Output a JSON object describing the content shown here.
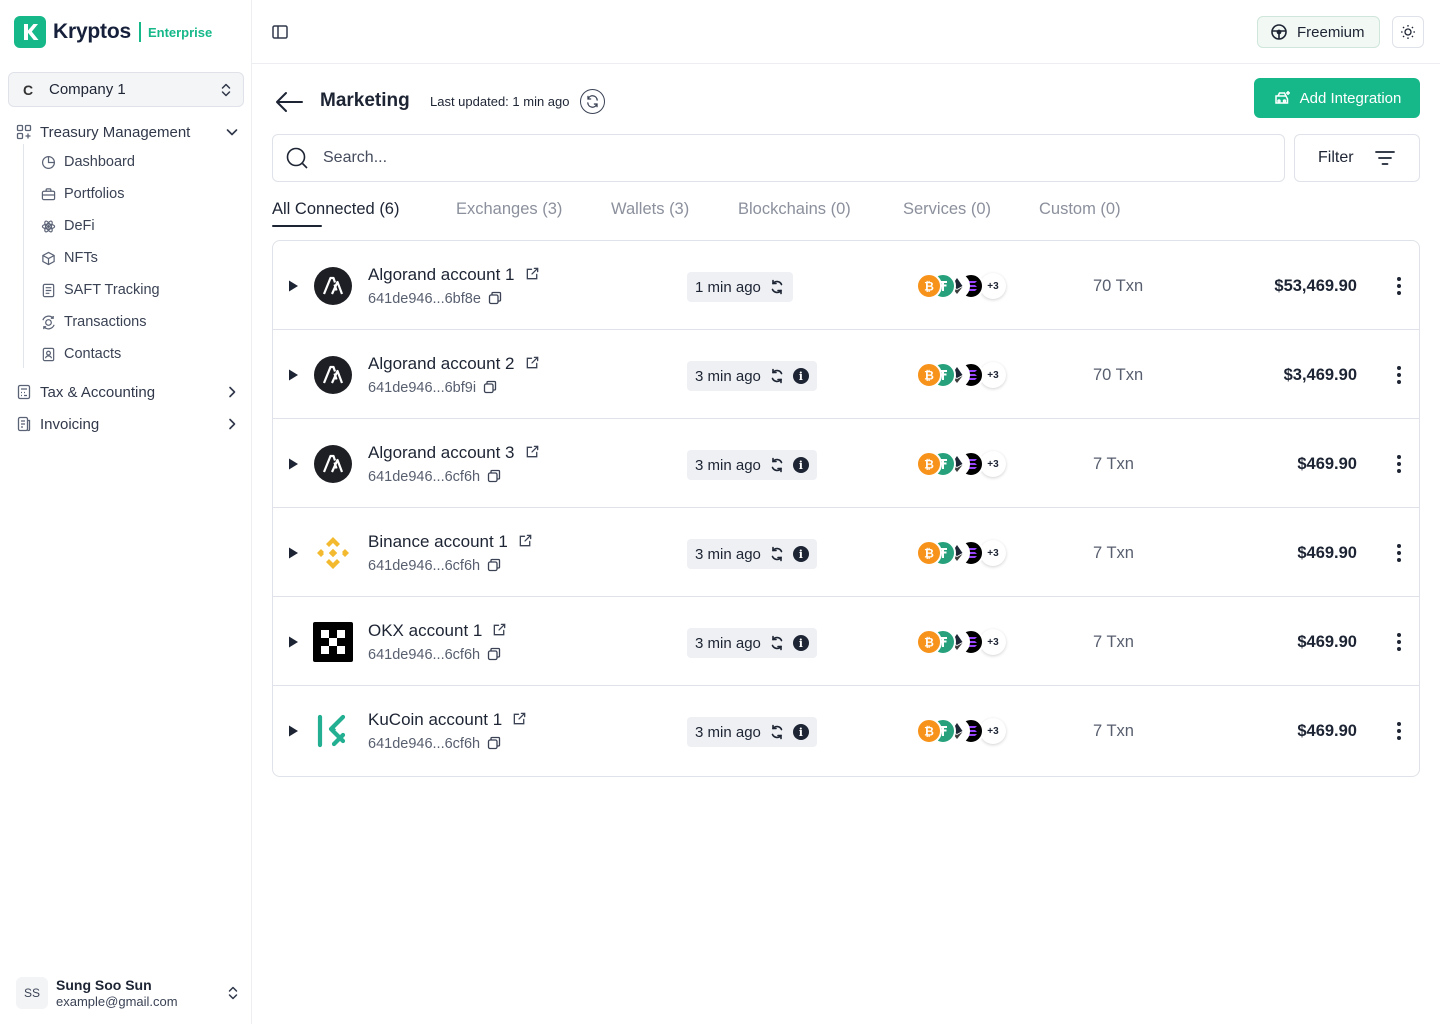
{
  "brand": {
    "name": "Kryptos",
    "tag": "Enterprise",
    "accent": "#16b88a"
  },
  "company": {
    "badge": "C",
    "name": "Company 1"
  },
  "nav": {
    "treasury": {
      "label": "Treasury Management",
      "items": [
        {
          "label": "Dashboard",
          "icon": "pie-chart-icon"
        },
        {
          "label": "Portfolios",
          "icon": "briefcase-icon"
        },
        {
          "label": "DeFi",
          "icon": "atom-icon"
        },
        {
          "label": "NFTs",
          "icon": "cube-icon"
        },
        {
          "label": "SAFT Tracking",
          "icon": "document-icon"
        },
        {
          "label": "Transactions",
          "icon": "transactions-icon"
        },
        {
          "label": "Contacts",
          "icon": "contact-icon"
        }
      ]
    },
    "tax": {
      "label": "Tax & Accounting"
    },
    "invoicing": {
      "label": "Invoicing"
    }
  },
  "user": {
    "initials": "SS",
    "name": "Sung Soo Sun",
    "email": "example@gmail.com"
  },
  "topbar": {
    "plan": "Freemium"
  },
  "header": {
    "title": "Marketing",
    "updated": "Last updated: 1 min ago",
    "add_label": "Add Integration"
  },
  "search": {
    "placeholder": "Search..."
  },
  "filter": {
    "label": "Filter"
  },
  "tabs": [
    {
      "label": "All Connected (6)",
      "active": true
    },
    {
      "label": "Exchanges (3)"
    },
    {
      "label": "Wallets (3)"
    },
    {
      "label": "Blockchains (0)"
    },
    {
      "label": "Services (0)"
    },
    {
      "label": "Custom (0)"
    }
  ],
  "rows": [
    {
      "name": "Algorand account 1",
      "address": "641de946...6bf8e",
      "synced": "1 min ago",
      "info": false,
      "coins_more": "+3",
      "txn": "70 Txn",
      "value": "$53,469.90",
      "logo": "algorand"
    },
    {
      "name": "Algorand account 2",
      "address": "641de946...6bf9i",
      "synced": "3 min ago",
      "info": true,
      "coins_more": "+3",
      "txn": "70 Txn",
      "value": "$3,469.90",
      "logo": "algorand"
    },
    {
      "name": "Algorand account 3",
      "address": "641de946...6cf6h",
      "synced": "3 min ago",
      "info": true,
      "coins_more": "+3",
      "txn": "7 Txn",
      "value": "$469.90",
      "logo": "algorand"
    },
    {
      "name": "Binance account 1",
      "address": "641de946...6cf6h",
      "synced": "3 min ago",
      "info": true,
      "coins_more": "+3",
      "txn": "7 Txn",
      "value": "$469.90",
      "logo": "binance"
    },
    {
      "name": "OKX account 1",
      "address": "641de946...6cf6h",
      "synced": "3 min ago",
      "info": true,
      "coins_more": "+3",
      "txn": "7 Txn",
      "value": "$469.90",
      "logo": "okx"
    },
    {
      "name": "KuCoin account 1",
      "address": "641de946...6cf6h",
      "synced": "3 min ago",
      "info": true,
      "coins_more": "+3",
      "txn": "7 Txn",
      "value": "$469.90",
      "logo": "kucoin"
    }
  ],
  "coin_colors": {
    "bitcoin": "#f7931a",
    "tether": "#26a17b",
    "ethereum": "#3c3c3d",
    "solana": "#9945ff"
  }
}
